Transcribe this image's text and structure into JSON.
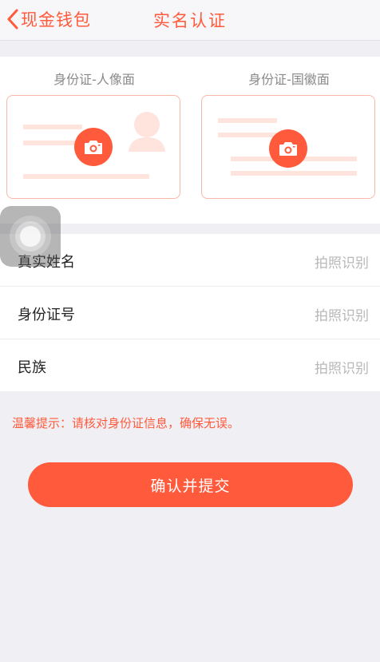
{
  "nav": {
    "back_label": "现金钱包",
    "title": "实名认证"
  },
  "id_cards": {
    "front_caption": "身份证-人像面",
    "back_caption": "身份证-国徽面"
  },
  "form": {
    "rows": [
      {
        "label": "真实姓名",
        "action": "拍照识别"
      },
      {
        "label": "身份证号",
        "action": "拍照识别"
      },
      {
        "label": "民族",
        "action": "拍照识别"
      }
    ]
  },
  "tip": "温馨提示：请核对身份证信息，确保无误。",
  "submit_label": "确认并提交",
  "colors": {
    "accent": "#ff5a3c",
    "background": "#efeff4",
    "card_line": "#ffe3dd"
  }
}
